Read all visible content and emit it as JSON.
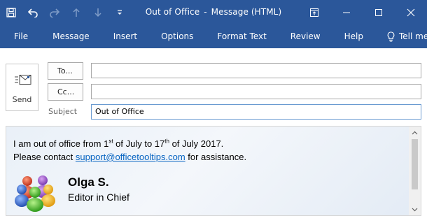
{
  "window": {
    "title": "Out of Office",
    "separator": "-",
    "subtitle": "Message (HTML)"
  },
  "colors": {
    "ribbon": "#2b579a",
    "link": "#0563c1"
  },
  "quick_access": {
    "icons": [
      "save-icon",
      "undo-icon",
      "redo-icon",
      "up-icon",
      "down-icon",
      "customize-icon"
    ]
  },
  "ribbon": {
    "tabs": [
      "File",
      "Message",
      "Insert",
      "Options",
      "Format Text",
      "Review",
      "Help"
    ],
    "tell_me": "Tell me"
  },
  "compose": {
    "send_label": "Send",
    "to_label": "To...",
    "cc_label": "Cc...",
    "to_value": "",
    "cc_value": "",
    "subject_label": "Subject",
    "subject_value": "Out of Office"
  },
  "message": {
    "line1_a": "I am out of office from 1",
    "line1_sup1": "st",
    "line1_b": " of July to 17",
    "line1_sup2": "th",
    "line1_c": " of July 2017.",
    "line2_a": "Please contact ",
    "line2_link": "support@officetooltips.com",
    "line2_b": " for assistance."
  },
  "signature": {
    "name": "Olga S.",
    "role": "Editor in Chief"
  }
}
